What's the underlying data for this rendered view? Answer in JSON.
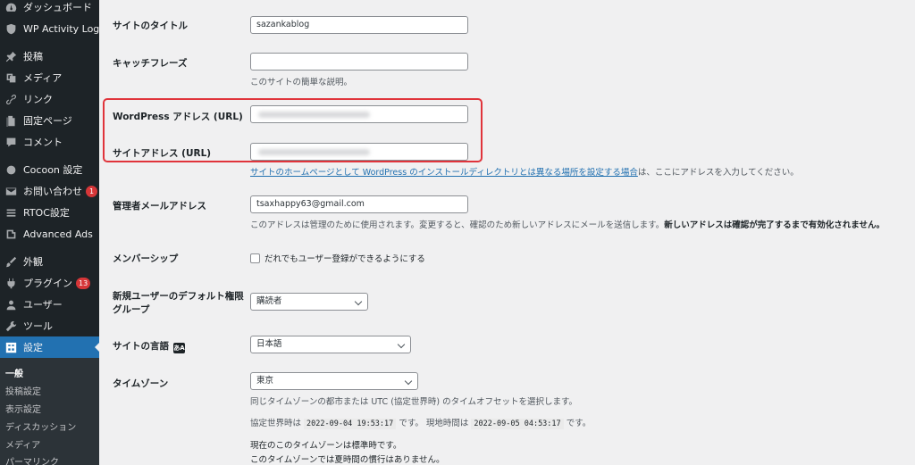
{
  "sidebar": {
    "items": [
      {
        "label": "ダッシュボード",
        "icon": "dashboard-icon"
      },
      {
        "label": "WP Activity Log",
        "icon": "shield-icon"
      },
      {
        "label": "投稿",
        "icon": "pin-icon"
      },
      {
        "label": "メディア",
        "icon": "media-icon"
      },
      {
        "label": "リンク",
        "icon": "link-icon"
      },
      {
        "label": "固定ページ",
        "icon": "page-icon"
      },
      {
        "label": "コメント",
        "icon": "comment-icon"
      },
      {
        "label": "Cocoon 設定",
        "icon": "cocoon-icon"
      },
      {
        "label": "お問い合わせ",
        "icon": "mail-icon",
        "badge": "1"
      },
      {
        "label": "RTOC設定",
        "icon": "list-icon"
      },
      {
        "label": "Advanced Ads",
        "icon": "ads-icon"
      },
      {
        "label": "外観",
        "icon": "brush-icon"
      },
      {
        "label": "プラグイン",
        "icon": "plugin-icon",
        "badge": "13"
      },
      {
        "label": "ユーザー",
        "icon": "user-icon"
      },
      {
        "label": "ツール",
        "icon": "wrench-icon"
      },
      {
        "label": "設定",
        "icon": "settings-icon"
      }
    ],
    "submenu": [
      "一般",
      "投稿設定",
      "表示設定",
      "ディスカッション",
      "メディア",
      "パーマリンク"
    ]
  },
  "form": {
    "site_title": {
      "label": "サイトのタイトル",
      "value": "sazankablog"
    },
    "tagline": {
      "label": "キャッチフレーズ",
      "value": "",
      "desc": "このサイトの簡単な説明。"
    },
    "wp_address": {
      "label": "WordPress アドレス (URL)"
    },
    "site_address": {
      "label": "サイトアドレス (URL)",
      "desc_link": "サイトのホームページとして WordPress のインストールディレクトリとは異なる場所を設定する場合",
      "desc_rest": "は、ここにアドレスを入力してください。"
    },
    "admin_email": {
      "label": "管理者メールアドレス",
      "value": "tsaxhappy63@gmail.com",
      "desc": "このアドレスは管理のために使用されます。変更すると、確認のため新しいアドレスにメールを送信します。",
      "desc_bold": "新しいアドレスは確認が完了するまで有効化されません。"
    },
    "membership": {
      "label": "メンバーシップ",
      "checkbox_label": "だれでもユーザー登録ができるようにする"
    },
    "default_role": {
      "label_line1": "新規ユーザーのデフォルト権限",
      "label_line2": "グループ",
      "value": "購読者"
    },
    "site_language": {
      "label": "サイトの言語",
      "value": "日本語"
    },
    "timezone": {
      "label": "タイムゾーン",
      "value": "東京",
      "desc": "同じタイムゾーンの都市または UTC (協定世界時) のタイムオフセットを選択します。",
      "utc_prefix": "協定世界時は",
      "utc_time": "2022-09-04 19:53:17",
      "utc_suffix": "です。 現地時間は",
      "local_time": "2022-09-05 04:53:17",
      "local_suffix": "です。",
      "note1": "現在のこのタイムゾーンは標準時です。",
      "note2": "このタイムゾーンでは夏時間の慣行はありません。"
    }
  },
  "colors": {
    "sidebar_bg": "#1d2327",
    "active": "#2271b1",
    "highlight": "#e0343b",
    "badge": "#d63638"
  }
}
